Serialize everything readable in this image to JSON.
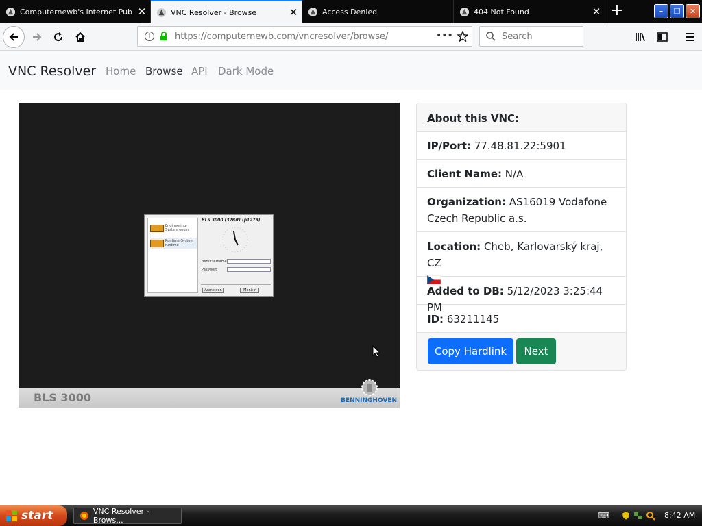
{
  "browser": {
    "tabs": [
      {
        "label": "Computernewb's Internet Pub Hu",
        "active": false
      },
      {
        "label": "VNC Resolver - Browse",
        "active": true
      },
      {
        "label": "Access Denied",
        "active": false
      },
      {
        "label": "404 Not Found",
        "active": false
      }
    ],
    "url_host": "https://computernewb.com",
    "url_path": "/vncresolver/browse/",
    "search_placeholder": "Search"
  },
  "site": {
    "brand": "VNC Resolver",
    "nav": [
      {
        "label": "Home",
        "active": false
      },
      {
        "label": "Browse",
        "active": true
      },
      {
        "label": "API",
        "active": false
      },
      {
        "label": "Dark Mode",
        "active": false
      }
    ]
  },
  "screenshot": {
    "footer_left": "BLS 3000",
    "footer_right": "BENNINGHOVEN",
    "login_title": "BLS 3000 (32Bit) (p1279)",
    "list_items": [
      "Engineering-System engin",
      "Runtime-System runtime"
    ],
    "username_label": "Benutzername",
    "password_label": "Passwort",
    "login_button": "Anmelden",
    "menu_button": "Menü ▾"
  },
  "info": {
    "header": "About this VNC:",
    "ip_label": "IP/Port:",
    "ip_value": "77.48.81.22:5901",
    "client_label": "Client Name:",
    "client_value": "N/A",
    "org_label": "Organization:",
    "org_value": "AS16019 Vodafone Czech Republic a.s.",
    "location_label": "Location:",
    "location_value": "Cheb, Karlovarský kraj, CZ",
    "added_label": "Added to DB:",
    "added_value": "5/12/2023 3:25:44 PM",
    "id_label": "ID:",
    "id_value": "63211145",
    "copy_button": "Copy Hardlink",
    "next_button": "Next"
  },
  "taskbar": {
    "start_label": "start",
    "task_label": "VNC Resolver - Brows...",
    "clock": "8:42 AM"
  }
}
